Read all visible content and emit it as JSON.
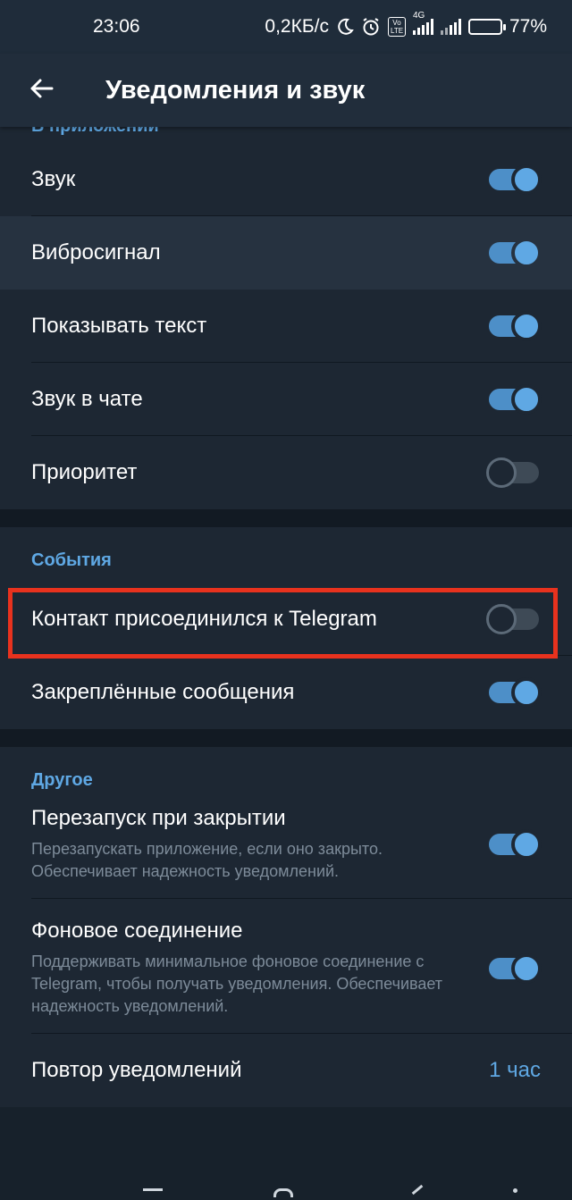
{
  "status_bar": {
    "time": "23:06",
    "speed": "0,2КБ/с",
    "volte": "Vo LTE",
    "network": "4G",
    "battery": "77%"
  },
  "app_bar": {
    "back_icon": "arrow-left-icon",
    "title": "Уведомления и звук"
  },
  "in_app": {
    "header": "В приложении",
    "items": [
      {
        "label": "Звук",
        "on": true
      },
      {
        "label": "Вибросигнал",
        "on": true
      },
      {
        "label": "Показывать текст",
        "on": true
      },
      {
        "label": "Звук в чате",
        "on": true
      },
      {
        "label": "Приоритет",
        "on": false
      }
    ]
  },
  "events": {
    "header": "События",
    "items": [
      {
        "label": "Контакт присоединился к Telegram",
        "on": false
      },
      {
        "label": "Закреплённые сообщения",
        "on": true
      }
    ]
  },
  "other": {
    "header": "Другое",
    "keep_alive": {
      "title": "Перезапуск при закрытии",
      "description": "Перезапускать приложение, если оно закрыто. Обеспечивает надежность уведомлений.",
      "on": true
    },
    "background": {
      "title": "Фоновое соединение",
      "description": "Поддерживать минимальное фоновое соединение с Telegram, чтобы получать уведомления. Обеспечивает надежность уведомлений.",
      "on": true
    },
    "repeat": {
      "label": "Повтор уведомлений",
      "value": "1 час"
    }
  },
  "colors": {
    "accent": "#5fa8e4",
    "background": "#1d2733",
    "highlight_frame": "#e8321e"
  }
}
